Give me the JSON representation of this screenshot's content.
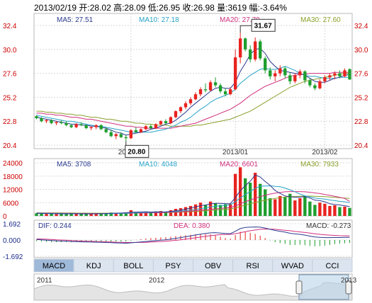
{
  "header": {
    "text": "2013/02/19 开:28.02 高:28.09 低:26.95 收:26.98 量:3619 幅:-3.64%"
  },
  "price": {
    "ma_labels": [
      {
        "text": "MA5: 27.51",
        "color": "#2b3a8f"
      },
      {
        "text": "MA10: 27.18",
        "color": "#27a3c8"
      },
      {
        "text": "MA20: 27.70",
        "color": "#d0307f"
      },
      {
        "text": "MA30: 27.60",
        "color": "#8aa02c"
      }
    ],
    "y_ticks": [
      "32.4",
      "30.0",
      "27.6",
      "25.2",
      "22.8",
      "20.4"
    ],
    "y_values": [
      32.4,
      30.0,
      27.6,
      25.2,
      22.8,
      20.4
    ],
    "y_range": [
      20.4,
      32.4
    ],
    "x_ticks": [
      "2012/12",
      "2013/01",
      "2013/02"
    ],
    "high_annot": "31.67",
    "low_annot": "20.80"
  },
  "volume": {
    "ma_labels": [
      {
        "text": "MA5: 3708",
        "color": "#2b3a8f"
      },
      {
        "text": "MA10: 4048",
        "color": "#27a3c8"
      },
      {
        "text": "MA20: 6601",
        "color": "#d0307f"
      },
      {
        "text": "MA30: 7933",
        "color": "#8aa02c"
      }
    ],
    "y_ticks": [
      "24000",
      "18000",
      "12000",
      "6000",
      "0"
    ],
    "y_range": [
      0,
      24000
    ]
  },
  "macd": {
    "labels": [
      {
        "text": "DIF: 0.244",
        "color": "#2b3a8f"
      },
      {
        "text": "DEA: 0.380",
        "color": "#d0307f"
      },
      {
        "text": "MACD: -0.273",
        "color": "#333333"
      }
    ],
    "y_ticks": [
      "1.692",
      "0.000",
      "-1.692"
    ]
  },
  "tabs": [
    "MACD",
    "KDJ",
    "BOLL",
    "PSY",
    "OBV",
    "RSI",
    "WVAD",
    "CCI"
  ],
  "active_tab": "MACD",
  "navigator": {
    "years": [
      "2011",
      "2012",
      "2013"
    ]
  },
  "colors": {
    "up": "#e8231f",
    "down": "#1e9e2e",
    "axis": "#cc0000",
    "tab_active": "#9fb9d8",
    "tab_bg": "#dbe4ef"
  },
  "chart_data": {
    "type": "candlestick",
    "candles": [
      [
        23.3,
        23.4,
        23.0,
        23.1
      ],
      [
        23.1,
        23.2,
        22.7,
        22.8
      ],
      [
        22.8,
        23.0,
        22.6,
        22.9
      ],
      [
        22.9,
        23.0,
        22.5,
        22.6
      ],
      [
        22.6,
        22.8,
        22.4,
        22.7
      ],
      [
        22.7,
        22.9,
        22.5,
        22.6
      ],
      [
        22.6,
        22.8,
        22.3,
        22.4
      ],
      [
        22.4,
        22.5,
        22.1,
        22.2
      ],
      [
        22.2,
        22.6,
        22.1,
        22.5
      ],
      [
        22.5,
        22.7,
        22.3,
        22.4
      ],
      [
        22.4,
        22.5,
        22.0,
        22.1
      ],
      [
        22.1,
        22.3,
        21.9,
        22.2
      ],
      [
        22.2,
        22.5,
        22.0,
        22.4
      ],
      [
        22.4,
        22.5,
        21.9,
        22.0
      ],
      [
        22.0,
        22.2,
        21.6,
        21.7
      ],
      [
        21.7,
        21.9,
        21.2,
        21.3
      ],
      [
        21.3,
        21.6,
        21.0,
        21.5
      ],
      [
        21.5,
        21.7,
        21.1,
        21.2
      ],
      [
        21.2,
        21.4,
        20.8,
        21.1
      ],
      [
        21.1,
        22.0,
        21.0,
        21.9
      ],
      [
        21.9,
        22.2,
        21.6,
        21.7
      ],
      [
        21.7,
        22.1,
        21.6,
        22.0
      ],
      [
        22.0,
        22.4,
        21.9,
        22.3
      ],
      [
        22.3,
        22.5,
        22.0,
        22.1
      ],
      [
        22.1,
        22.6,
        22.0,
        22.5
      ],
      [
        22.5,
        22.9,
        22.4,
        22.8
      ],
      [
        22.8,
        23.0,
        22.5,
        22.6
      ],
      [
        22.6,
        23.3,
        22.5,
        23.2
      ],
      [
        23.2,
        23.9,
        23.1,
        23.8
      ],
      [
        23.8,
        24.3,
        23.6,
        24.2
      ],
      [
        24.2,
        24.8,
        24.0,
        24.6
      ],
      [
        24.6,
        25.2,
        24.4,
        25.0
      ],
      [
        25.0,
        25.7,
        24.9,
        25.5
      ],
      [
        25.5,
        26.2,
        25.3,
        26.0
      ],
      [
        26.0,
        26.6,
        25.7,
        25.9
      ],
      [
        25.9,
        26.9,
        25.8,
        26.7
      ],
      [
        26.7,
        27.2,
        26.2,
        26.4
      ],
      [
        26.4,
        26.6,
        25.6,
        25.8
      ],
      [
        25.8,
        26.1,
        25.3,
        25.5
      ],
      [
        25.5,
        26.2,
        25.4,
        26.0
      ],
      [
        26.0,
        30.0,
        25.9,
        29.2
      ],
      [
        29.2,
        31.67,
        28.6,
        31.1
      ],
      [
        31.1,
        31.2,
        29.8,
        30.0
      ],
      [
        30.0,
        30.4,
        28.7,
        29.0
      ],
      [
        29.0,
        31.2,
        28.8,
        30.8
      ],
      [
        30.8,
        31.0,
        28.9,
        29.1
      ],
      [
        29.1,
        29.3,
        27.6,
        27.9
      ],
      [
        27.9,
        28.2,
        27.0,
        27.3
      ],
      [
        27.3,
        27.9,
        26.8,
        27.6
      ],
      [
        27.6,
        28.4,
        27.3,
        28.1
      ],
      [
        28.1,
        28.3,
        27.1,
        27.4
      ],
      [
        27.4,
        27.7,
        26.5,
        26.8
      ],
      [
        26.8,
        27.6,
        26.6,
        27.4
      ],
      [
        27.4,
        28.0,
        27.1,
        27.8
      ],
      [
        27.8,
        27.9,
        26.6,
        26.9
      ],
      [
        26.9,
        27.1,
        26.2,
        26.4
      ],
      [
        26.4,
        26.6,
        25.9,
        26.1
      ],
      [
        26.1,
        27.0,
        26.0,
        26.8
      ],
      [
        26.8,
        27.4,
        26.6,
        27.2
      ],
      [
        27.2,
        27.6,
        26.9,
        27.4
      ],
      [
        27.4,
        27.8,
        27.0,
        27.6
      ],
      [
        27.6,
        27.9,
        27.1,
        27.3
      ],
      [
        27.3,
        28.1,
        27.2,
        27.9
      ],
      [
        28.02,
        28.09,
        26.95,
        26.98
      ]
    ],
    "ma_series": [
      {
        "name": "MA5",
        "values": [
          23.2,
          23.1,
          23.0,
          22.9,
          22.8,
          22.7,
          22.6,
          22.5,
          22.5,
          22.4,
          22.4,
          22.3,
          22.3,
          22.2,
          22.1,
          21.9,
          21.7,
          21.6,
          21.4,
          21.5,
          21.6,
          21.7,
          21.8,
          22.0,
          22.1,
          22.3,
          22.5,
          22.6,
          22.9,
          23.3,
          23.7,
          24.2,
          24.6,
          25.0,
          25.4,
          25.8,
          26.1,
          26.2,
          26.1,
          26.1,
          26.7,
          27.8,
          28.6,
          29.5,
          30.0,
          30.1,
          29.6,
          28.8,
          28.3,
          27.9,
          27.8,
          27.7,
          27.6,
          27.6,
          27.4,
          27.1,
          26.8,
          26.7,
          26.7,
          26.9,
          27.1,
          27.2,
          27.4,
          27.5
        ]
      },
      {
        "name": "MA10",
        "values": [
          23.4,
          23.3,
          23.2,
          23.1,
          23.0,
          22.9,
          22.8,
          22.8,
          22.7,
          22.6,
          22.5,
          22.4,
          22.3,
          22.3,
          22.2,
          22.1,
          22.0,
          21.9,
          21.8,
          21.7,
          21.7,
          21.7,
          21.7,
          21.7,
          21.8,
          21.9,
          22.0,
          22.2,
          22.4,
          22.7,
          22.9,
          23.2,
          23.6,
          24.0,
          24.3,
          24.7,
          25.0,
          25.2,
          25.4,
          25.6,
          26.0,
          26.6,
          27.0,
          27.4,
          27.7,
          28.0,
          28.1,
          28.0,
          28.0,
          28.1,
          28.3,
          28.1,
          27.9,
          27.6,
          27.4,
          27.3,
          27.3,
          27.2,
          27.1,
          27.1,
          27.1,
          27.2,
          27.2,
          27.2
        ]
      },
      {
        "name": "MA20",
        "values": [
          23.6,
          23.6,
          23.5,
          23.5,
          23.4,
          23.4,
          23.3,
          23.2,
          23.2,
          23.1,
          23.0,
          23.0,
          22.9,
          22.8,
          22.7,
          22.6,
          22.5,
          22.4,
          22.3,
          22.3,
          22.2,
          22.2,
          22.1,
          22.1,
          22.1,
          22.1,
          22.1,
          22.1,
          22.2,
          22.3,
          22.4,
          22.5,
          22.6,
          22.8,
          23.0,
          23.2,
          23.4,
          23.6,
          23.8,
          24.0,
          24.3,
          24.6,
          25.0,
          25.4,
          25.7,
          26.0,
          26.3,
          26.5,
          26.7,
          26.9,
          27.1,
          27.3,
          27.4,
          27.5,
          27.5,
          27.6,
          27.6,
          27.6,
          27.6,
          27.6,
          27.7,
          27.7,
          27.7,
          27.7
        ]
      },
      {
        "name": "MA30",
        "values": [
          23.8,
          23.8,
          23.7,
          23.7,
          23.6,
          23.6,
          23.5,
          23.5,
          23.4,
          23.4,
          23.3,
          23.2,
          23.2,
          23.1,
          23.0,
          23.0,
          22.9,
          22.8,
          22.8,
          22.7,
          22.6,
          22.6,
          22.5,
          22.5,
          22.4,
          22.4,
          22.4,
          22.3,
          22.3,
          22.3,
          22.3,
          22.3,
          22.4,
          22.4,
          22.5,
          22.6,
          22.7,
          22.8,
          22.9,
          23.0,
          23.2,
          23.4,
          23.6,
          23.8,
          24.1,
          24.4,
          24.7,
          25.0,
          25.3,
          25.6,
          25.9,
          26.2,
          26.4,
          26.6,
          26.8,
          26.9,
          27.0,
          27.1,
          27.2,
          27.3,
          27.4,
          27.5,
          27.6,
          27.6
        ]
      }
    ],
    "volumes": [
      1200,
      1000,
      900,
      1100,
      800,
      900,
      1000,
      1100,
      900,
      800,
      1000,
      900,
      1100,
      1200,
      1300,
      1500,
      1200,
      1400,
      1600,
      2600,
      1800,
      1500,
      1900,
      1400,
      2000,
      2200,
      1800,
      2600,
      3200,
      3500,
      4000,
      4500,
      5200,
      6000,
      5000,
      6500,
      5800,
      5000,
      5300,
      5500,
      19000,
      22000,
      17000,
      15000,
      19500,
      14500,
      12000,
      8000,
      7500,
      9000,
      8500,
      10000,
      7000,
      8000,
      9000,
      6500,
      5000,
      6000,
      5500,
      4500,
      4800,
      4000,
      4200,
      3619
    ],
    "vol_ma": [
      {
        "name": "MA5",
        "values": [
          1200,
          1150,
          1100,
          1050,
          1000,
          950,
          950,
          1000,
          980,
          940,
          960,
          940,
          980,
          1000,
          1100,
          1220,
          1260,
          1320,
          1440,
          1660,
          1720,
          1780,
          1880,
          1760,
          1840,
          1800,
          1860,
          2000,
          2360,
          2660,
          3060,
          3560,
          4080,
          4640,
          4940,
          5440,
          5700,
          5660,
          5520,
          5560,
          8260,
          11400,
          13700,
          15700,
          18500,
          17600,
          15600,
          13800,
          11500,
          10200,
          9000,
          8700,
          8400,
          8500,
          8700,
          8100,
          7100,
          6900,
          6400,
          5500,
          5160,
          4960,
          4600,
          4224
        ]
      },
      {
        "name": "MA10",
        "values": [
          1200,
          1180,
          1150,
          1120,
          1100,
          1080,
          1050,
          1040,
          1020,
          1000,
          980,
          960,
          960,
          970,
          990,
          1060,
          1100,
          1150,
          1220,
          1320,
          1440,
          1500,
          1570,
          1610,
          1690,
          1740,
          1790,
          1890,
          2030,
          2200,
          2410,
          2680,
          2980,
          3320,
          3600,
          4020,
          4390,
          4620,
          4810,
          5030,
          6360,
          8150,
          9680,
          11030,
          12470,
          13420,
          13500,
          13600,
          13340,
          13200,
          12600,
          11800,
          10900,
          9900,
          9100,
          8600,
          8100,
          7800,
          7600,
          7200,
          6900,
          6600,
          6400,
          6000
        ]
      },
      {
        "name": "MA20",
        "values": [
          1300,
          1280,
          1260,
          1240,
          1220,
          1200,
          1180,
          1160,
          1140,
          1120,
          1100,
          1080,
          1070,
          1060,
          1060,
          1080,
          1100,
          1120,
          1160,
          1220,
          1280,
          1320,
          1370,
          1410,
          1460,
          1510,
          1560,
          1650,
          1760,
          1880,
          2020,
          2180,
          2360,
          2560,
          2740,
          2960,
          3180,
          3380,
          3580,
          3780,
          4520,
          5500,
          6400,
          7200,
          8000,
          8700,
          9300,
          9900,
          10300,
          10600,
          10900,
          11000,
          11000,
          11000,
          10900,
          10700,
          10400,
          10100,
          9700,
          9300,
          8900,
          8400,
          7900,
          6601
        ]
      },
      {
        "name": "MA30",
        "values": [
          1400,
          1390,
          1380,
          1370,
          1350,
          1340,
          1320,
          1300,
          1290,
          1280,
          1270,
          1260,
          1250,
          1240,
          1240,
          1240,
          1250,
          1260,
          1280,
          1310,
          1340,
          1370,
          1400,
          1430,
          1460,
          1490,
          1520,
          1580,
          1650,
          1720,
          1820,
          1930,
          2050,
          2190,
          2320,
          2470,
          2630,
          2780,
          2940,
          3100,
          3600,
          4300,
          4900,
          5500,
          6100,
          6600,
          7100,
          7500,
          7900,
          8200,
          8500,
          8700,
          8800,
          8900,
          8950,
          8950,
          8900,
          8800,
          8700,
          8550,
          8400,
          8250,
          8100,
          7933
        ]
      }
    ],
    "dif": [
      0.05,
      0.02,
      -0.02,
      -0.05,
      -0.08,
      -0.1,
      -0.12,
      -0.14,
      -0.15,
      -0.17,
      -0.18,
      -0.19,
      -0.2,
      -0.21,
      -0.23,
      -0.25,
      -0.27,
      -0.28,
      -0.3,
      -0.26,
      -0.22,
      -0.18,
      -0.14,
      -0.1,
      -0.06,
      -0.02,
      0.02,
      0.08,
      0.15,
      0.22,
      0.3,
      0.38,
      0.46,
      0.54,
      0.6,
      0.66,
      0.68,
      0.64,
      0.6,
      0.58,
      0.8,
      1.05,
      1.15,
      1.18,
      1.2,
      1.18,
      1.1,
      0.98,
      0.88,
      0.8,
      0.72,
      0.62,
      0.56,
      0.52,
      0.45,
      0.36,
      0.28,
      0.24,
      0.22,
      0.22,
      0.23,
      0.23,
      0.24,
      0.244
    ],
    "dea": [
      0.1,
      0.09,
      0.07,
      0.05,
      0.02,
      0.0,
      -0.02,
      -0.05,
      -0.07,
      -0.09,
      -0.11,
      -0.12,
      -0.14,
      -0.15,
      -0.17,
      -0.18,
      -0.2,
      -0.21,
      -0.23,
      -0.23,
      -0.23,
      -0.22,
      -0.21,
      -0.19,
      -0.16,
      -0.14,
      -0.11,
      -0.07,
      -0.03,
      0.02,
      0.08,
      0.14,
      0.2,
      0.27,
      0.33,
      0.4,
      0.45,
      0.49,
      0.51,
      0.52,
      0.58,
      0.67,
      0.77,
      0.85,
      0.92,
      0.98,
      1.01,
      1.0,
      0.98,
      0.94,
      0.9,
      0.85,
      0.79,
      0.74,
      0.69,
      0.63,
      0.57,
      0.52,
      0.48,
      0.45,
      0.42,
      0.4,
      0.39,
      0.38
    ]
  }
}
